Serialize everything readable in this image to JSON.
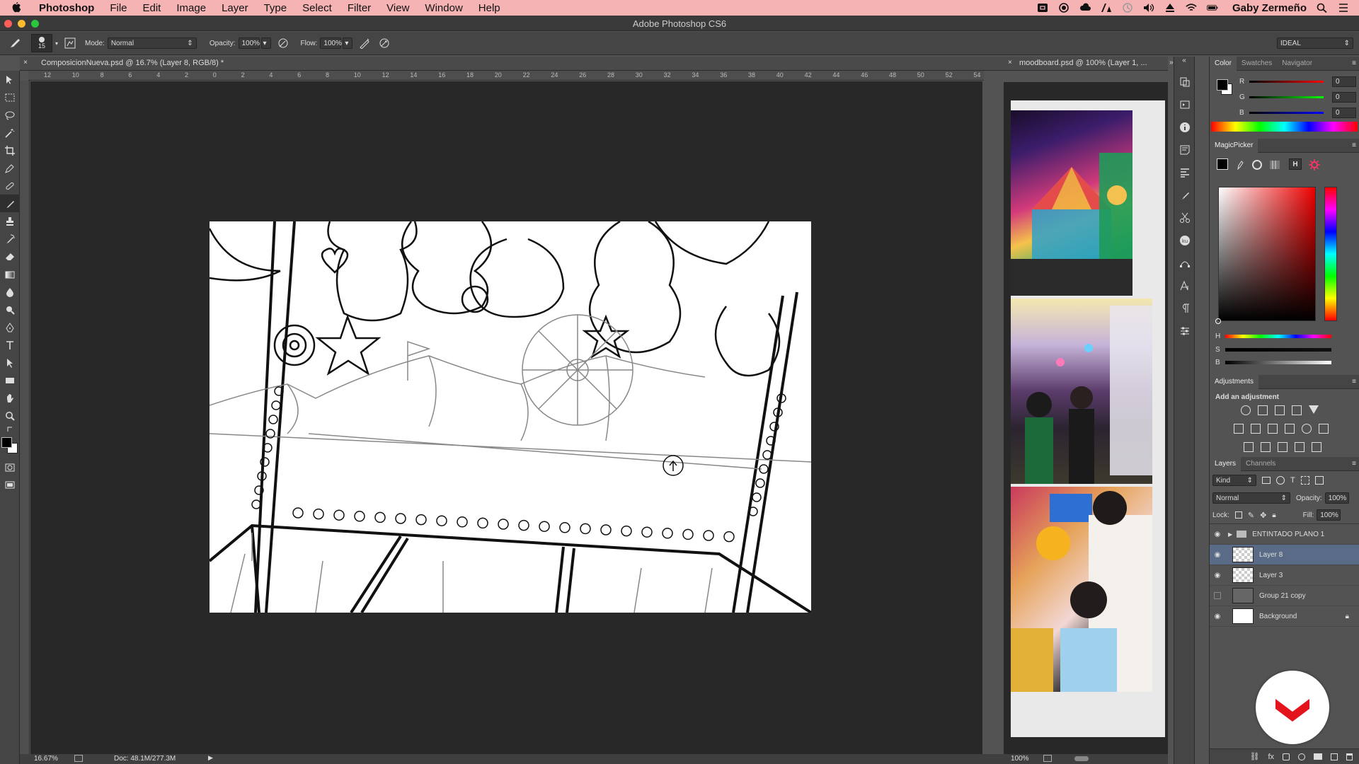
{
  "menubar": {
    "app_name": "Photoshop",
    "items": [
      "File",
      "Edit",
      "Image",
      "Layer",
      "Type",
      "Select",
      "Filter",
      "View",
      "Window",
      "Help"
    ],
    "user": "Gaby Zermeño"
  },
  "window": {
    "title": "Adobe Photoshop CS6"
  },
  "options_bar": {
    "brush_size": "15",
    "mode_label": "Mode:",
    "mode_value": "Normal",
    "opacity_label": "Opacity:",
    "opacity_value": "100%",
    "flow_label": "Flow:",
    "flow_value": "100%",
    "workspace": "IDEAL"
  },
  "document": {
    "tab_title": "ComposicionNueva.psd @ 16.7% (Layer 8, RGB/8) *",
    "ruler_ticks": [
      "12",
      "10",
      "8",
      "6",
      "4",
      "2",
      "0",
      "2",
      "4",
      "6",
      "8",
      "10",
      "12",
      "14",
      "16",
      "18",
      "20",
      "22",
      "24",
      "26",
      "28",
      "30",
      "32",
      "34",
      "36",
      "38",
      "40",
      "42",
      "44",
      "46",
      "48",
      "50",
      "52",
      "54"
    ],
    "zoom": "16.67%",
    "doc_size": "Doc: 48.1M/277.3M"
  },
  "moodboard": {
    "tab_title": "moodboard.psd @ 100% (Layer 1, ...",
    "zoom": "100%"
  },
  "color_panel": {
    "tabs": [
      "Color",
      "Swatches",
      "Navigator"
    ],
    "r": "0",
    "g": "0",
    "b": "0",
    "r_label": "R",
    "g_label": "G",
    "b_label": "B"
  },
  "magicpicker": {
    "title": "MagicPicker",
    "mode_h": "H",
    "h_label": "H",
    "s_label": "S",
    "b_label": "B"
  },
  "adjustments": {
    "title": "Adjustments",
    "subtitle": "Add an adjustment"
  },
  "layers_panel": {
    "tabs": [
      "Layers",
      "Channels"
    ],
    "kind": "Kind",
    "blend_mode": "Normal",
    "opacity_label": "Opacity:",
    "opacity_value": "100%",
    "lock_label": "Lock:",
    "fill_label": "Fill:",
    "fill_value": "100%",
    "layers": [
      {
        "name": "ENTINTADO PLANO 1",
        "type": "group",
        "visible": true
      },
      {
        "name": "Layer 8",
        "type": "layer",
        "visible": true,
        "selected": true
      },
      {
        "name": "Layer 3",
        "type": "layer",
        "visible": true
      },
      {
        "name": "Group 21 copy",
        "type": "layer",
        "visible": false
      },
      {
        "name": "Background",
        "type": "background",
        "visible": true,
        "locked": true
      }
    ]
  },
  "colors": {
    "menubar_bg": "#f6b3b3",
    "panel_bg": "#535353",
    "selected_layer": "#5a6b88",
    "logo_red": "#e3141b"
  }
}
